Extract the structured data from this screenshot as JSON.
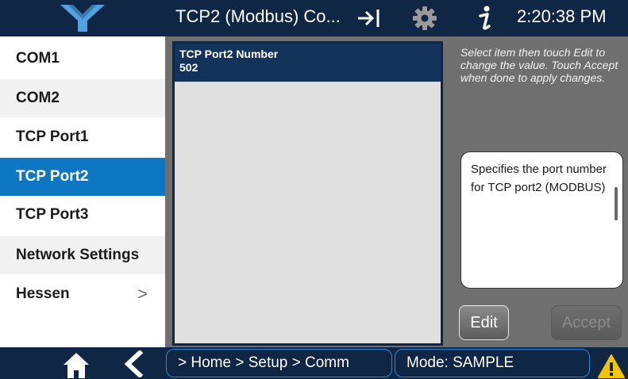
{
  "header": {
    "title": "TCP2 (Modbus) Co...",
    "clock": "2:20:38 PM",
    "logo_icon": "company-logo",
    "exit_icon": "exit-arrow-icon",
    "settings_icon": "gear-icon",
    "info_icon": "info-icon"
  },
  "sidebar": {
    "items": [
      {
        "label": "COM1"
      },
      {
        "label": "COM2"
      },
      {
        "label": "TCP Port1"
      },
      {
        "label": "TCP Port2",
        "selected": true
      },
      {
        "label": "TCP Port3"
      },
      {
        "label": "Network Settings"
      },
      {
        "label": "Hessen",
        "has_submenu": true
      }
    ],
    "submenu_chevron": ">"
  },
  "main": {
    "list": [
      {
        "label": "TCP Port2 Number",
        "value": "502",
        "selected": true
      }
    ],
    "hint": "Select item then touch Edit to change the value. Touch Accept when done to apply changes.",
    "description": "Specifies the port number for TCP port2 (MODBUS)",
    "edit_label": "Edit",
    "accept_label": "Accept"
  },
  "footer": {
    "breadcrumb": "> Home > Setup > Comm",
    "mode": "Mode: SAMPLE",
    "home_icon": "home-icon",
    "back_icon": "back-chevron-icon",
    "warning_icon": "warning-icon"
  },
  "colors": {
    "header_bg": "#0f2744",
    "accent": "#0d77c4",
    "panel_bg": "#6f6f6f",
    "warning": "#f5c400"
  }
}
